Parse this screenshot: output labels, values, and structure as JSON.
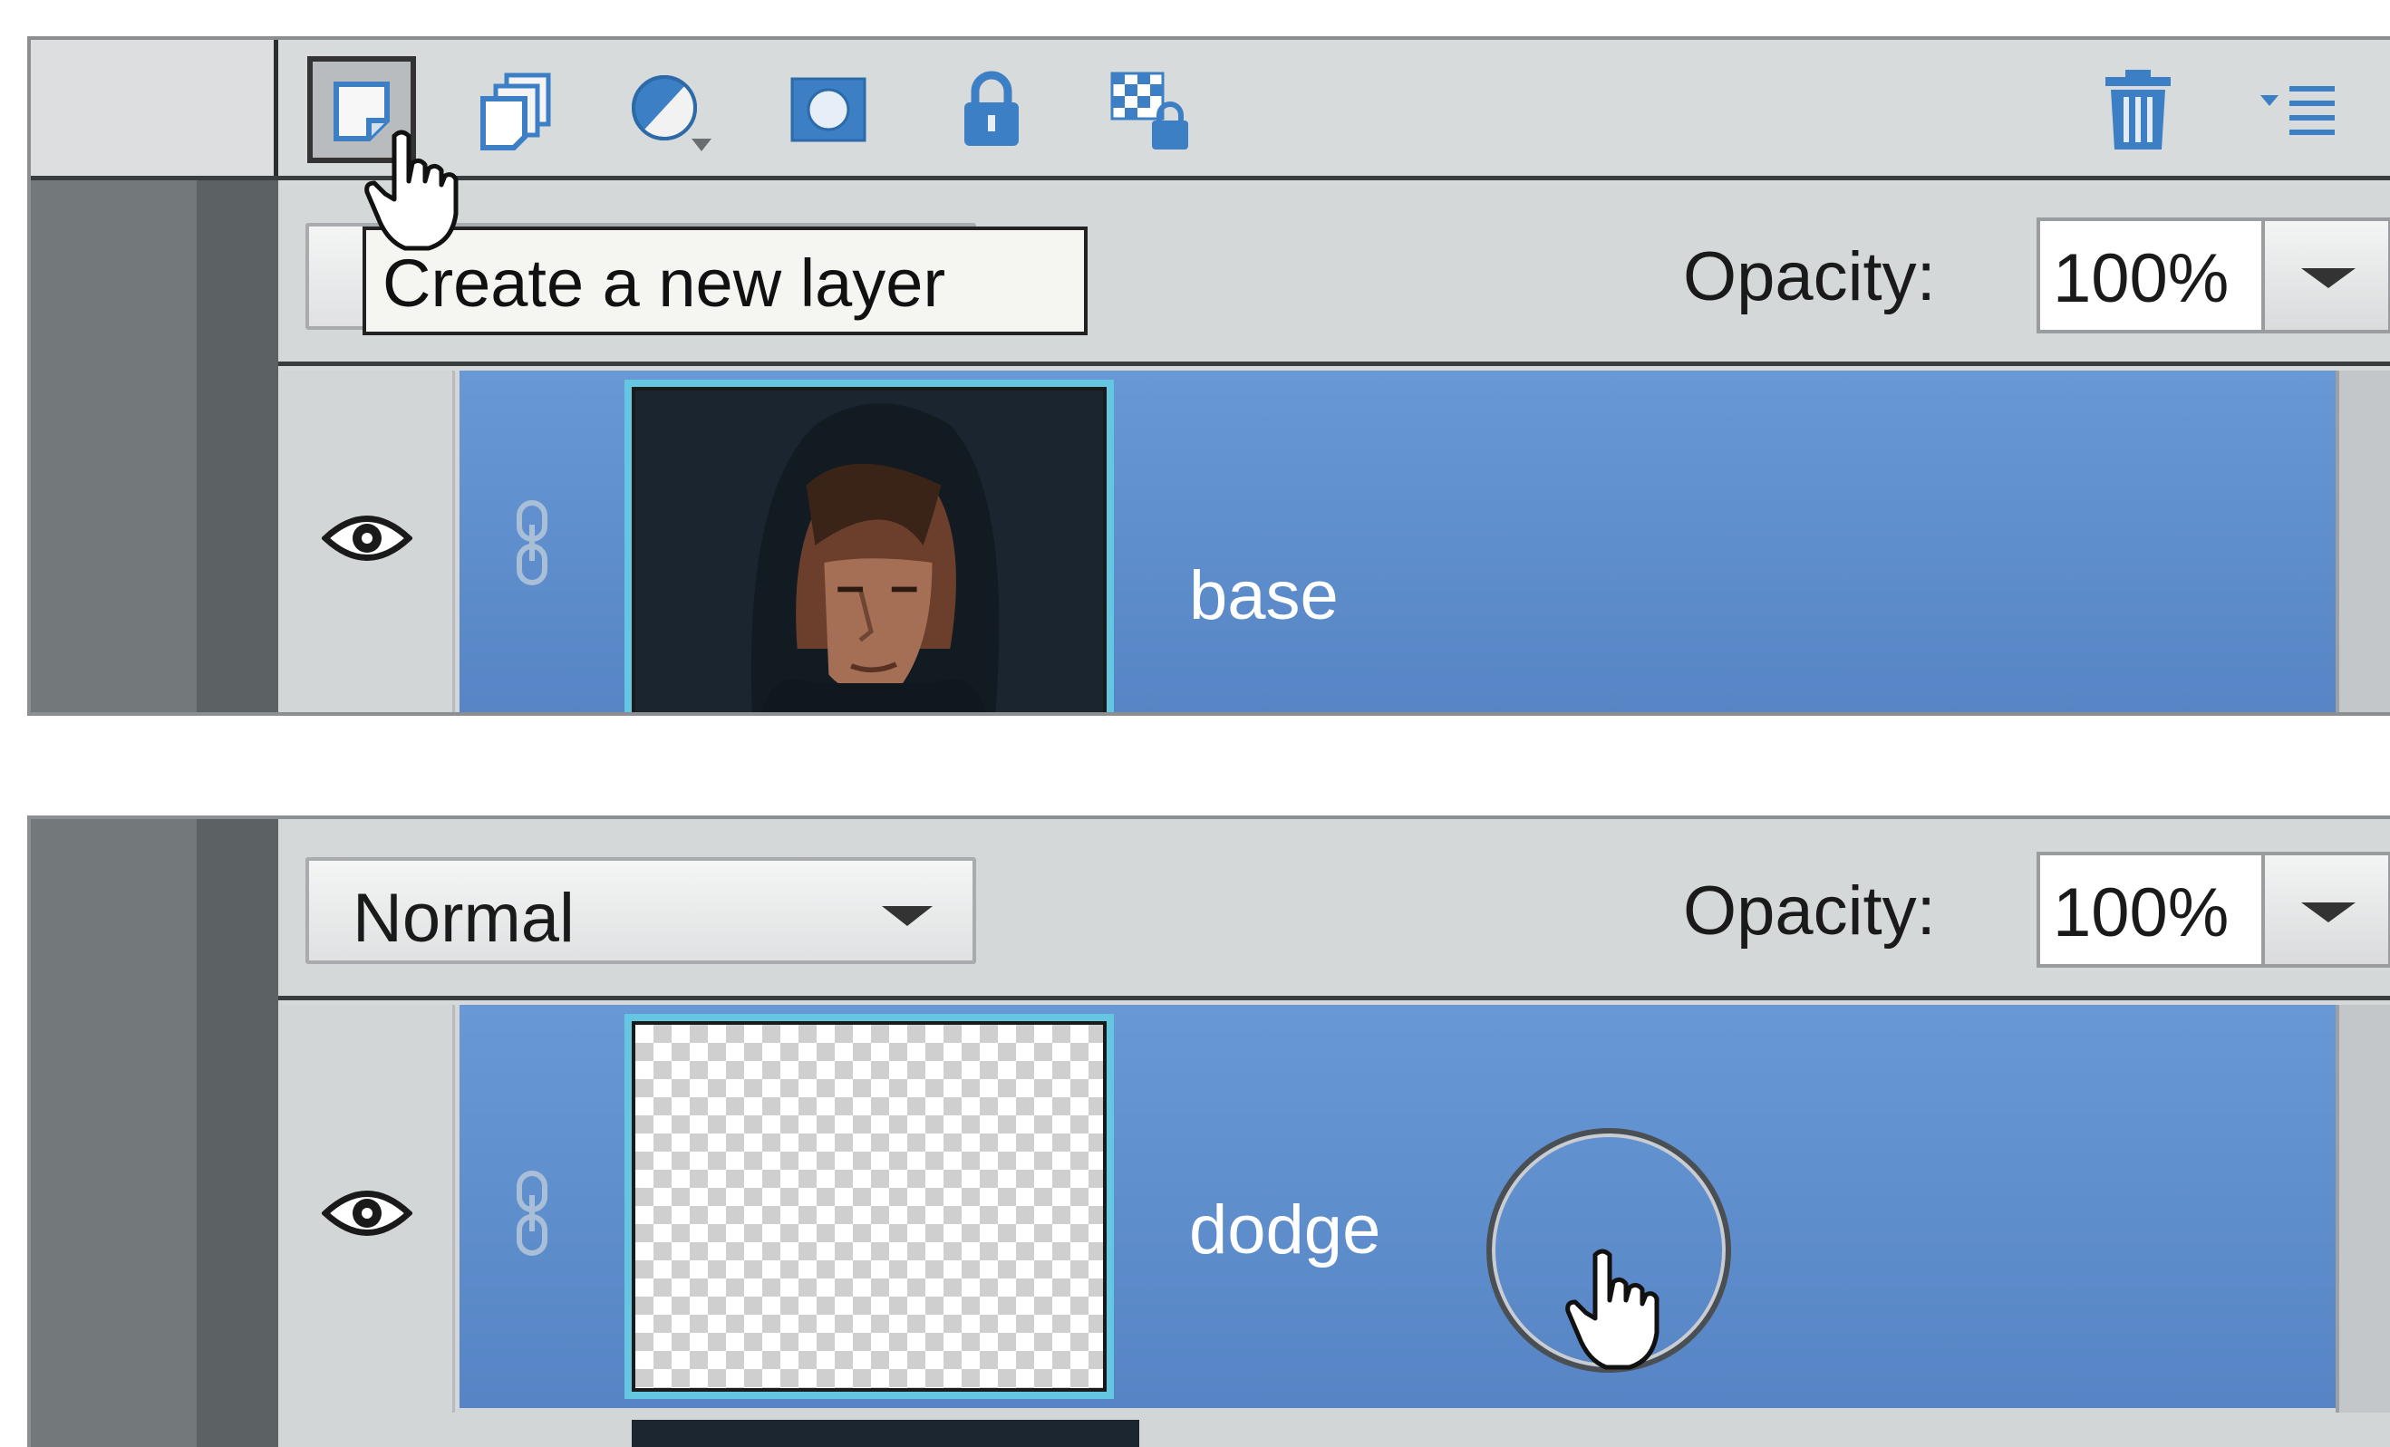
{
  "toolbar": {
    "tools": [
      {
        "icon": "new-layer-icon",
        "active": true
      },
      {
        "icon": "duplicate-layer-icon"
      },
      {
        "icon": "adjustment-layer-icon"
      },
      {
        "icon": "layer-mask-icon"
      },
      {
        "icon": "lock-all-icon"
      },
      {
        "icon": "lock-transparent-icon"
      }
    ],
    "delete_icon": "trash-icon",
    "menu_icon": "panel-menu-icon"
  },
  "tooltip": {
    "text": "Create a new layer"
  },
  "top_panel": {
    "opacity_label": "Opacity:",
    "opacity_value": "100%",
    "layer": {
      "name": "base",
      "thumbnail": "photo-portrait"
    }
  },
  "bottom_panel": {
    "blend_mode": "Normal",
    "opacity_label": "Opacity:",
    "opacity_value": "100%",
    "layer": {
      "name": "dodge",
      "thumbnail": "transparent"
    }
  },
  "colors": {
    "selected_layer": "#5c8fcf",
    "thumb_border": "#64c6e0",
    "panel_bg": "#d6d9da",
    "icon_blue": "#3d7fc4"
  }
}
